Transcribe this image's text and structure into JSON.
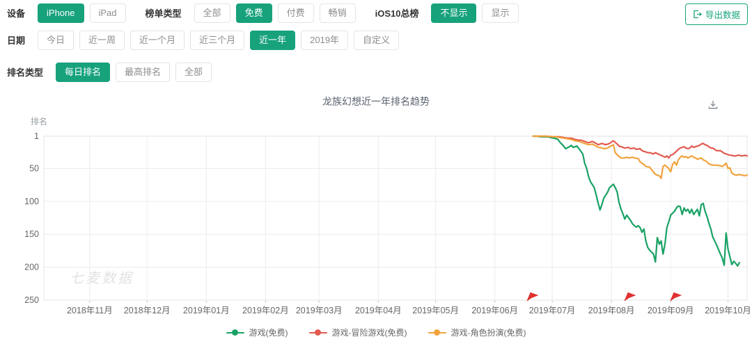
{
  "colors": {
    "accent": "#17a27c",
    "flag": "#e03131",
    "axis_text": "#666666",
    "grid": "#ececec"
  },
  "filters": {
    "device": {
      "label": "设备",
      "options": [
        {
          "label": "iPhone",
          "selected": true
        },
        {
          "label": "iPad",
          "selected": false
        }
      ]
    },
    "chart_type": {
      "label": "榜单类型",
      "options": [
        {
          "label": "全部",
          "selected": false
        },
        {
          "label": "免费",
          "selected": true
        },
        {
          "label": "付费",
          "selected": false
        },
        {
          "label": "畅销",
          "selected": false
        }
      ]
    },
    "ios10": {
      "label": "iOS10总榜",
      "options": [
        {
          "label": "不显示",
          "selected": true
        },
        {
          "label": "显示",
          "selected": false
        }
      ]
    },
    "export_label": "导出数据",
    "date": {
      "label": "日期",
      "options": [
        {
          "label": "今日",
          "selected": false
        },
        {
          "label": "近一周",
          "selected": false
        },
        {
          "label": "近一个月",
          "selected": false
        },
        {
          "label": "近三个月",
          "selected": false
        },
        {
          "label": "近一年",
          "selected": true
        },
        {
          "label": "2019年",
          "selected": false
        },
        {
          "label": "自定义",
          "selected": false
        }
      ]
    },
    "rank_type": {
      "label": "排名类型",
      "options": [
        {
          "label": "每日排名",
          "selected": true
        },
        {
          "label": "最高排名",
          "selected": false
        },
        {
          "label": "全部",
          "selected": false
        }
      ]
    }
  },
  "chart": {
    "title": "龙族幻想近一年排名趋势",
    "y_axis_name": "排名",
    "watermark": "七麦数据"
  },
  "chart_data": {
    "type": "line",
    "title": "龙族幻想近一年排名趋势",
    "ylabel": "排名",
    "y_axis_inverted": true,
    "y_ticks": [
      1,
      50,
      100,
      150,
      200,
      250
    ],
    "x_tick_labels": [
      "2018年11月",
      "2018年12月",
      "2019年01月",
      "2019年02月",
      "2019年03月",
      "2019年04月",
      "2019年05月",
      "2019年06月",
      "2019年07月",
      "2019年08月",
      "2019年09月",
      "2019年10月"
    ],
    "x_tick_days": [
      24,
      54,
      85,
      116,
      144,
      175,
      205,
      236,
      266,
      297,
      328,
      358
    ],
    "x_domain_days": [
      0,
      368
    ],
    "x_domain_dates": [
      "2018-10-08",
      "2019-10-11"
    ],
    "event_flag_days": [
      253,
      304,
      328
    ],
    "legend_position": "bottom",
    "grid": true,
    "series": [
      {
        "name": "游戏(免费)",
        "color": "#18a263",
        "points": [
          [
            256,
            1
          ],
          [
            258,
            1
          ],
          [
            260,
            2
          ],
          [
            262,
            2
          ],
          [
            264,
            2
          ],
          [
            265,
            3
          ],
          [
            267,
            4
          ],
          [
            269,
            6
          ],
          [
            270,
            10
          ],
          [
            272,
            16
          ],
          [
            273,
            20
          ],
          [
            275,
            17
          ],
          [
            276,
            15
          ],
          [
            277,
            18
          ],
          [
            279,
            16
          ],
          [
            280,
            20
          ],
          [
            282,
            28
          ],
          [
            283,
            42
          ],
          [
            284,
            50
          ],
          [
            285,
            62
          ],
          [
            286,
            70
          ],
          [
            288,
            79
          ],
          [
            289,
            90
          ],
          [
            290,
            102
          ],
          [
            291,
            113
          ],
          [
            292,
            105
          ],
          [
            293,
            95
          ],
          [
            295,
            86
          ],
          [
            296,
            79
          ],
          [
            298,
            74
          ],
          [
            299,
            79
          ],
          [
            300,
            86
          ],
          [
            301,
            102
          ],
          [
            302,
            112
          ],
          [
            303,
            119
          ],
          [
            304,
            127
          ],
          [
            305,
            121
          ],
          [
            307,
            129
          ],
          [
            308,
            134
          ],
          [
            309,
            137
          ],
          [
            310,
            139
          ],
          [
            311,
            137
          ],
          [
            312,
            140
          ],
          [
            313,
            147
          ],
          [
            314,
            142
          ],
          [
            315,
            160
          ],
          [
            316,
            170
          ],
          [
            317,
            174
          ],
          [
            319,
            180
          ],
          [
            320,
            192
          ],
          [
            321,
            155
          ],
          [
            322,
            165
          ],
          [
            323,
            160
          ],
          [
            324,
            180
          ],
          [
            325,
            165
          ],
          [
            326,
            140
          ],
          [
            327,
            131
          ],
          [
            328,
            121
          ],
          [
            330,
            115
          ],
          [
            331,
            110
          ],
          [
            332,
            107
          ],
          [
            333,
            108
          ],
          [
            334,
            120
          ],
          [
            335,
            110
          ],
          [
            336,
            115
          ],
          [
            337,
            112
          ],
          [
            338,
            118
          ],
          [
            339,
            112
          ],
          [
            340,
            120
          ],
          [
            342,
            112
          ],
          [
            343,
            122
          ],
          [
            344,
            105
          ],
          [
            345,
            103
          ],
          [
            346,
            115
          ],
          [
            347,
            123
          ],
          [
            348,
            133
          ],
          [
            349,
            142
          ],
          [
            350,
            154
          ],
          [
            351,
            160
          ],
          [
            352,
            166
          ],
          [
            354,
            180
          ],
          [
            355,
            186
          ],
          [
            356,
            197
          ],
          [
            357,
            148
          ],
          [
            358,
            173
          ],
          [
            359,
            184
          ],
          [
            360,
            196
          ],
          [
            361,
            191
          ],
          [
            362,
            194
          ],
          [
            363,
            198
          ],
          [
            364,
            193
          ]
        ]
      },
      {
        "name": "游戏-冒险游戏(免费)",
        "color": "#e25a50",
        "points": [
          [
            256,
            1
          ],
          [
            260,
            1
          ],
          [
            263,
            1
          ],
          [
            267,
            2
          ],
          [
            270,
            2
          ],
          [
            272,
            3
          ],
          [
            274,
            4
          ],
          [
            276,
            4
          ],
          [
            278,
            6
          ],
          [
            280,
            7
          ],
          [
            281,
            7
          ],
          [
            283,
            9
          ],
          [
            285,
            11
          ],
          [
            287,
            9
          ],
          [
            289,
            12
          ],
          [
            290,
            14
          ],
          [
            292,
            12
          ],
          [
            294,
            14
          ],
          [
            296,
            12
          ],
          [
            297,
            10
          ],
          [
            298,
            8
          ],
          [
            300,
            13
          ],
          [
            301,
            16
          ],
          [
            303,
            18
          ],
          [
            304,
            19
          ],
          [
            306,
            18
          ],
          [
            307,
            20
          ],
          [
            309,
            19
          ],
          [
            310,
            21
          ],
          [
            312,
            20
          ],
          [
            313,
            23
          ],
          [
            314,
            24
          ],
          [
            316,
            26
          ],
          [
            317,
            26
          ],
          [
            319,
            28
          ],
          [
            320,
            26
          ],
          [
            322,
            29
          ],
          [
            323,
            30
          ],
          [
            325,
            33
          ],
          [
            326,
            31
          ],
          [
            327,
            34
          ],
          [
            328,
            30
          ],
          [
            329,
            29
          ],
          [
            331,
            24
          ],
          [
            332,
            21
          ],
          [
            333,
            19
          ],
          [
            334,
            18
          ],
          [
            335,
            17
          ],
          [
            336,
            19
          ],
          [
            337,
            20
          ],
          [
            338,
            19
          ],
          [
            339,
            16
          ],
          [
            340,
            18
          ],
          [
            341,
            17
          ],
          [
            343,
            15
          ],
          [
            344,
            13
          ],
          [
            345,
            12
          ],
          [
            346,
            14
          ],
          [
            347,
            15
          ],
          [
            348,
            17
          ],
          [
            349,
            19
          ],
          [
            350,
            19
          ],
          [
            351,
            21
          ],
          [
            352,
            23
          ],
          [
            354,
            23
          ],
          [
            355,
            25
          ],
          [
            356,
            27
          ],
          [
            357,
            28
          ],
          [
            358,
            29
          ],
          [
            359,
            30
          ],
          [
            360,
            30
          ],
          [
            361,
            31
          ],
          [
            362,
            31
          ],
          [
            363,
            30
          ],
          [
            364,
            30
          ],
          [
            365,
            31
          ],
          [
            367,
            30
          ],
          [
            368,
            31
          ]
        ]
      },
      {
        "name": "游戏-角色扮演(免费)",
        "color": "#f2a23c",
        "points": [
          [
            256,
            1
          ],
          [
            260,
            1
          ],
          [
            263,
            1
          ],
          [
            267,
            2
          ],
          [
            270,
            3
          ],
          [
            272,
            4
          ],
          [
            274,
            5
          ],
          [
            276,
            6
          ],
          [
            278,
            8
          ],
          [
            280,
            9
          ],
          [
            281,
            10
          ],
          [
            283,
            12
          ],
          [
            285,
            14
          ],
          [
            287,
            13
          ],
          [
            289,
            16
          ],
          [
            290,
            18
          ],
          [
            291,
            18
          ],
          [
            292,
            19
          ],
          [
            293,
            20
          ],
          [
            295,
            19
          ],
          [
            296,
            17
          ],
          [
            298,
            14
          ],
          [
            299,
            26
          ],
          [
            301,
            32
          ],
          [
            302,
            34
          ],
          [
            304,
            34
          ],
          [
            305,
            33
          ],
          [
            306,
            34
          ],
          [
            308,
            33
          ],
          [
            309,
            34
          ],
          [
            311,
            35
          ],
          [
            312,
            40
          ],
          [
            314,
            44
          ],
          [
            315,
            47
          ],
          [
            317,
            48
          ],
          [
            318,
            52
          ],
          [
            320,
            59
          ],
          [
            321,
            60
          ],
          [
            322,
            61
          ],
          [
            323,
            65
          ],
          [
            324,
            47
          ],
          [
            325,
            45
          ],
          [
            327,
            50
          ],
          [
            328,
            55
          ],
          [
            329,
            44
          ],
          [
            330,
            40
          ],
          [
            331,
            45
          ],
          [
            332,
            37
          ],
          [
            333,
            33
          ],
          [
            334,
            31
          ],
          [
            335,
            33
          ],
          [
            336,
            32
          ],
          [
            337,
            34
          ],
          [
            339,
            31
          ],
          [
            340,
            33
          ],
          [
            341,
            34
          ],
          [
            342,
            36
          ],
          [
            343,
            35
          ],
          [
            344,
            34
          ],
          [
            345,
            37
          ],
          [
            346,
            38
          ],
          [
            347,
            40
          ],
          [
            348,
            43
          ],
          [
            349,
            44
          ],
          [
            350,
            45
          ],
          [
            351,
            45
          ],
          [
            352,
            45
          ],
          [
            354,
            46
          ],
          [
            355,
            47
          ],
          [
            356,
            45
          ],
          [
            357,
            42
          ],
          [
            358,
            50
          ],
          [
            359,
            49
          ],
          [
            360,
            57
          ],
          [
            361,
            59
          ],
          [
            362,
            60
          ],
          [
            363,
            60
          ],
          [
            364,
            59
          ],
          [
            365,
            60
          ],
          [
            367,
            61
          ],
          [
            368,
            60
          ]
        ]
      }
    ]
  }
}
